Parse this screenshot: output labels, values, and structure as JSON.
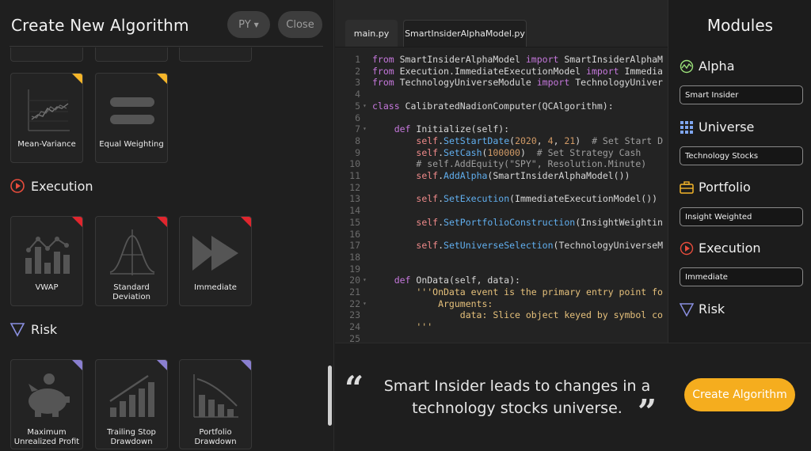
{
  "header": {
    "title": "Create New Algorithm",
    "language": "PY",
    "close_label": "Close"
  },
  "portfolio_cards": [
    {
      "label": "Mean-Variance",
      "corner_color": "#f4b52a",
      "icon": "line-chart-icon"
    },
    {
      "label": "Equal Weighting",
      "corner_color": "#f4b52a",
      "icon": "equal-bars-icon"
    }
  ],
  "execution_section": {
    "title": "Execution",
    "color": "#e74c3c"
  },
  "execution_cards": [
    {
      "label": "VWAP",
      "corner_color": "#e0262e",
      "icon": "vwap-icon"
    },
    {
      "label": "Standard Deviation",
      "corner_color": "#e0262e",
      "icon": "bell-curve-icon"
    },
    {
      "label": "Immediate",
      "corner_color": "#e0262e",
      "icon": "fast-forward-icon"
    }
  ],
  "risk_section": {
    "title": "Risk",
    "color": "#8a8fe0"
  },
  "risk_cards": [
    {
      "label": "Maximum Unrealized Profit",
      "corner_color": "#8a7fd0",
      "icon": "piggy-bank-icon"
    },
    {
      "label": "Trailing Stop Drawdown",
      "corner_color": "#8a7fd0",
      "icon": "stairs-chart-icon"
    },
    {
      "label": "Portfolio Drawdown",
      "corner_color": "#8a7fd0",
      "icon": "drawdown-chart-icon"
    }
  ],
  "editor": {
    "tabs": [
      "main.py",
      "SmartInsiderAlphaModel.py"
    ],
    "active_tab": "SmartInsiderAlphaModel.py",
    "lines": [
      {
        "n": "1",
        "fold": "",
        "text": "from SmartInsiderAlphaModel import SmartInsiderAlphaM"
      },
      {
        "n": "2",
        "fold": "",
        "text": "from Execution.ImmediateExecutionModel import Immedia"
      },
      {
        "n": "3",
        "fold": "",
        "text": "from TechnologyUniverseModule import TechnologyUniver"
      },
      {
        "n": "4",
        "fold": "",
        "text": ""
      },
      {
        "n": "5",
        "fold": "▾",
        "text": "class CalibratedNadionComputer(QCAlgorithm):"
      },
      {
        "n": "6",
        "fold": "",
        "text": ""
      },
      {
        "n": "7",
        "fold": "▾",
        "text": "    def Initialize(self):"
      },
      {
        "n": "8",
        "fold": "",
        "text": "        self.SetStartDate(2020, 4, 21)  # Set Start D"
      },
      {
        "n": "9",
        "fold": "",
        "text": "        self.SetCash(100000)  # Set Strategy Cash"
      },
      {
        "n": "10",
        "fold": "",
        "text": "        # self.AddEquity(\"SPY\", Resolution.Minute)"
      },
      {
        "n": "11",
        "fold": "",
        "text": "        self.AddAlpha(SmartInsiderAlphaModel())"
      },
      {
        "n": "12",
        "fold": "",
        "text": ""
      },
      {
        "n": "13",
        "fold": "",
        "text": "        self.SetExecution(ImmediateExecutionModel())"
      },
      {
        "n": "14",
        "fold": "",
        "text": ""
      },
      {
        "n": "15",
        "fold": "",
        "text": "        self.SetPortfolioConstruction(InsightWeightin"
      },
      {
        "n": "16",
        "fold": "",
        "text": ""
      },
      {
        "n": "17",
        "fold": "",
        "text": "        self.SetUniverseSelection(TechnologyUniverseM"
      },
      {
        "n": "18",
        "fold": "",
        "text": ""
      },
      {
        "n": "19",
        "fold": "",
        "text": ""
      },
      {
        "n": "20",
        "fold": "▾",
        "text": "    def OnData(self, data):"
      },
      {
        "n": "21",
        "fold": "",
        "text": "        '''OnData event is the primary entry point fo"
      },
      {
        "n": "22",
        "fold": "▾",
        "text": "            Arguments:"
      },
      {
        "n": "23",
        "fold": "",
        "text": "                data: Slice object keyed by symbol co"
      },
      {
        "n": "24",
        "fold": "",
        "text": "        '''"
      },
      {
        "n": "25",
        "fold": "",
        "text": ""
      }
    ]
  },
  "modules": {
    "title": "Modules",
    "items": [
      {
        "name": "Alpha",
        "value": "Smart Insider",
        "icon": "alpha-icon",
        "color": "#9be07a"
      },
      {
        "name": "Universe",
        "value": "Technology Stocks",
        "icon": "universe-grid-icon",
        "color": "#7fa6f0"
      },
      {
        "name": "Portfolio",
        "value": "Insight Weighted",
        "icon": "briefcase-icon",
        "color": "#f4b52a"
      },
      {
        "name": "Execution",
        "value": "Immediate",
        "icon": "execution-icon",
        "color": "#e74c3c"
      },
      {
        "name": "Risk",
        "value": "",
        "icon": "risk-triangle-icon",
        "color": "#8a8fe0"
      }
    ]
  },
  "footer": {
    "quote_line1": "Smart Insider leads to changes in a",
    "quote_line2": "technology stocks universe.",
    "create_label": "Create Algorithm",
    "accent": "#f5ad1e"
  }
}
